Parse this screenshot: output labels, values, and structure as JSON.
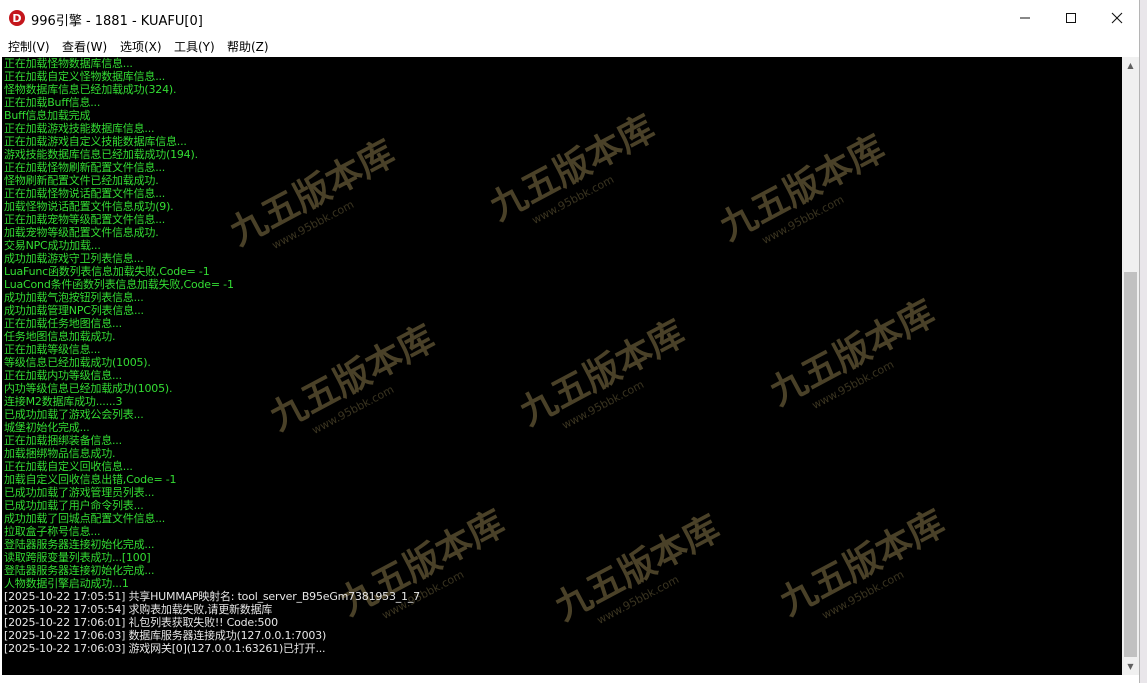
{
  "window": {
    "title": "996引擎 - 1881 - KUAFU[0]",
    "icon_letter": "D",
    "controls": {
      "minimize": "—",
      "maximize": "☐",
      "close": "✕"
    }
  },
  "menu": [
    "控制(V)",
    "查看(W)",
    "选项(X)",
    "工具(Y)",
    "帮助(Z)"
  ],
  "colors": {
    "log_green": "#33dd33",
    "log_white": "#e6e6e6",
    "background": "#000000"
  },
  "watermark": {
    "text": "九五版本库",
    "url": "www.95bbk.com"
  },
  "log": [
    {
      "t": "正在加载怪物数据库信息...",
      "c": "green"
    },
    {
      "t": "正在加载自定义怪物数据库信息...",
      "c": "green"
    },
    {
      "t": "怪物数据库信息已经加载成功(324).",
      "c": "green"
    },
    {
      "t": "正在加载Buff信息...",
      "c": "green"
    },
    {
      "t": "Buff信息加载完成",
      "c": "green"
    },
    {
      "t": "正在加载游戏技能数据库信息...",
      "c": "green"
    },
    {
      "t": "正在加载游戏自定义技能数据库信息...",
      "c": "green"
    },
    {
      "t": "游戏技能数据库信息已经加载成功(194).",
      "c": "green"
    },
    {
      "t": "正在加载怪物刷新配置文件信息...",
      "c": "green"
    },
    {
      "t": "怪物刷新配置文件已经加载成功.",
      "c": "green"
    },
    {
      "t": "正在加载怪物说话配置文件信息...",
      "c": "green"
    },
    {
      "t": "加载怪物说话配置文件信息成功(9).",
      "c": "green"
    },
    {
      "t": "正在加载宠物等级配置文件信息...",
      "c": "green"
    },
    {
      "t": "加载宠物等级配置文件信息成功.",
      "c": "green"
    },
    {
      "t": "交易NPC成功加载...",
      "c": "green"
    },
    {
      "t": "成功加载游戏守卫列表信息...",
      "c": "green"
    },
    {
      "t": "LuaFunc函数列表信息加载失败,Code= -1",
      "c": "green"
    },
    {
      "t": "LuaCond条件函数列表信息加载失败,Code= -1",
      "c": "green"
    },
    {
      "t": "成功加载气泡按钮列表信息...",
      "c": "green"
    },
    {
      "t": "成功加载管理NPC列表信息...",
      "c": "green"
    },
    {
      "t": "正在加载任务地图信息...",
      "c": "green"
    },
    {
      "t": "任务地图信息加载成功.",
      "c": "green"
    },
    {
      "t": "正在加载等级信息...",
      "c": "green"
    },
    {
      "t": "等级信息已经加载成功(1005).",
      "c": "green"
    },
    {
      "t": "正在加载内功等级信息...",
      "c": "green"
    },
    {
      "t": "内功等级信息已经加载成功(1005).",
      "c": "green"
    },
    {
      "t": "连接M2数据库成功......3",
      "c": "green"
    },
    {
      "t": "已成功加载了游戏公会列表...",
      "c": "green"
    },
    {
      "t": "城堡初始化完成...",
      "c": "green"
    },
    {
      "t": "正在加载捆绑装备信息...",
      "c": "green"
    },
    {
      "t": "加载捆绑物品信息成功.",
      "c": "green"
    },
    {
      "t": "正在加载自定义回收信息...",
      "c": "green"
    },
    {
      "t": "加载自定义回收信息出错,Code= -1",
      "c": "green"
    },
    {
      "t": "已成功加载了游戏管理员列表...",
      "c": "green"
    },
    {
      "t": "已成功加载了用户命令列表...",
      "c": "green"
    },
    {
      "t": "成功加载了回城点配置文件信息...",
      "c": "green"
    },
    {
      "t": "拉取盒子称号信息...",
      "c": "green"
    },
    {
      "t": "登陆器服务器连接初始化完成...",
      "c": "green"
    },
    {
      "t": "读取跨服变量列表成功...[100]",
      "c": "green"
    },
    {
      "t": "登陆器服务器连接初始化完成...",
      "c": "green"
    },
    {
      "t": "人物数据引擎启动成功...1",
      "c": "green"
    },
    {
      "t": "[2025-10-22 17:05:51] 共享HUMMAP映射名: tool_server_B95eGm7381953_1_7",
      "c": "white"
    },
    {
      "t": "[2025-10-22 17:05:54] 求购表加载失败,请更新数据库",
      "c": "white"
    },
    {
      "t": "[2025-10-22 17:06:01] 礼包列表获取失败!! Code:500",
      "c": "white"
    },
    {
      "t": "[2025-10-22 17:06:03] 数据库服务器连接成功(127.0.0.1:7003)",
      "c": "white"
    },
    {
      "t": "[2025-10-22 17:06:03] 游戏网关[0](127.0.0.1:63261)已打开...",
      "c": "white"
    }
  ]
}
